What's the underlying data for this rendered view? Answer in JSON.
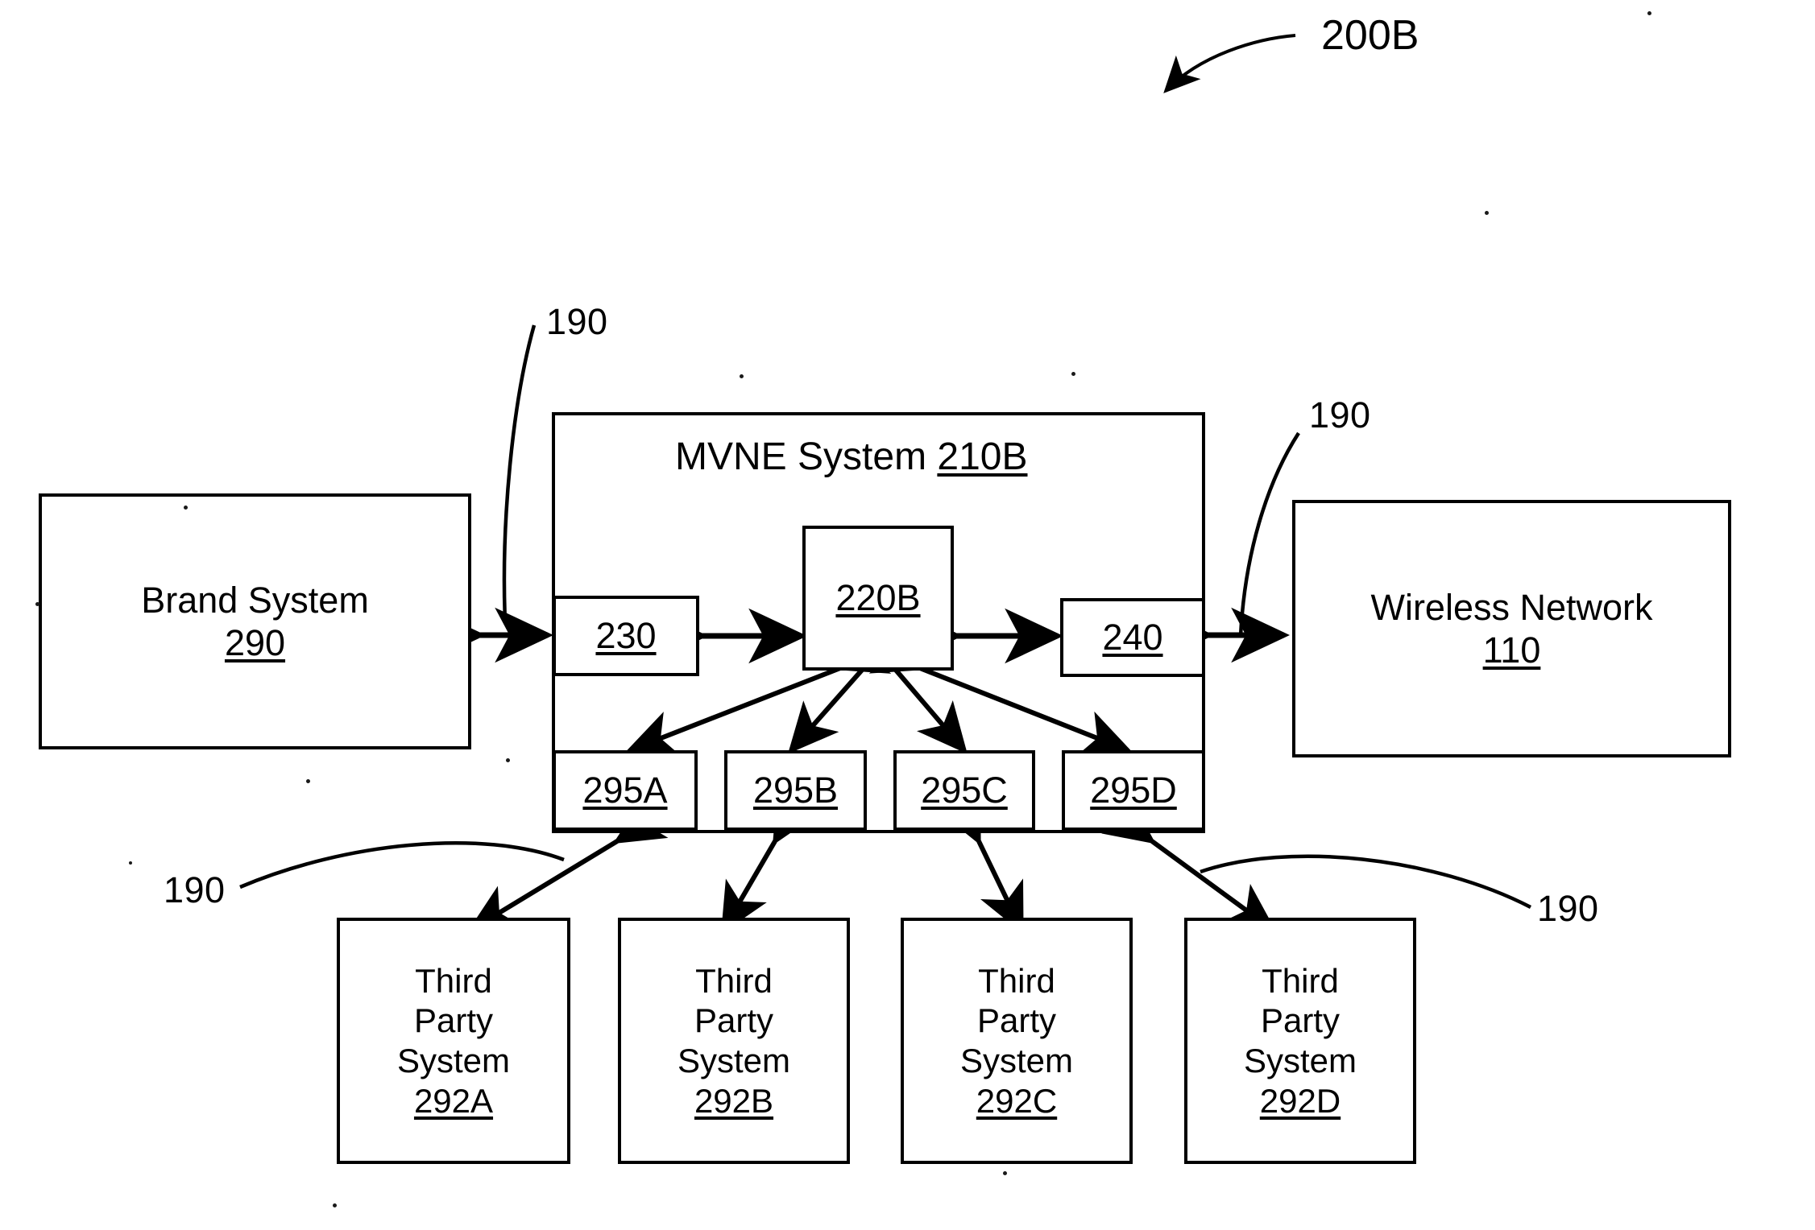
{
  "figure": {
    "label": "200B"
  },
  "mvne": {
    "title_text": "MVNE System ",
    "title_ref": "210B",
    "modules": [
      {
        "id": "m230",
        "ref": "230"
      },
      {
        "id": "m220b",
        "ref": "220B"
      },
      {
        "id": "m240",
        "ref": "240"
      }
    ],
    "interfaces": [
      {
        "id": "i295a",
        "ref": "295A"
      },
      {
        "id": "i295b",
        "ref": "295B"
      },
      {
        "id": "i295c",
        "ref": "295C"
      },
      {
        "id": "i295d",
        "ref": "295D"
      }
    ]
  },
  "external": {
    "brand_system": {
      "line1": "Brand System",
      "ref": "290"
    },
    "wireless_network": {
      "line1": "Wireless Network",
      "ref": "110"
    },
    "third_party_systems": [
      {
        "l1": "Third",
        "l2": "Party",
        "l3": "System",
        "ref": "292A"
      },
      {
        "l1": "Third",
        "l2": "Party",
        "l3": "System",
        "ref": "292B"
      },
      {
        "l1": "Third",
        "l2": "Party",
        "l3": "System",
        "ref": "292C"
      },
      {
        "l1": "Third",
        "l2": "Party",
        "l3": "System",
        "ref": "292D"
      }
    ]
  },
  "connector_labels": {
    "top_left": "190",
    "top_right": "190",
    "bottom_left": "190",
    "bottom_right": "190"
  },
  "colors": {
    "ink": "#000000",
    "paper": "#ffffff"
  }
}
